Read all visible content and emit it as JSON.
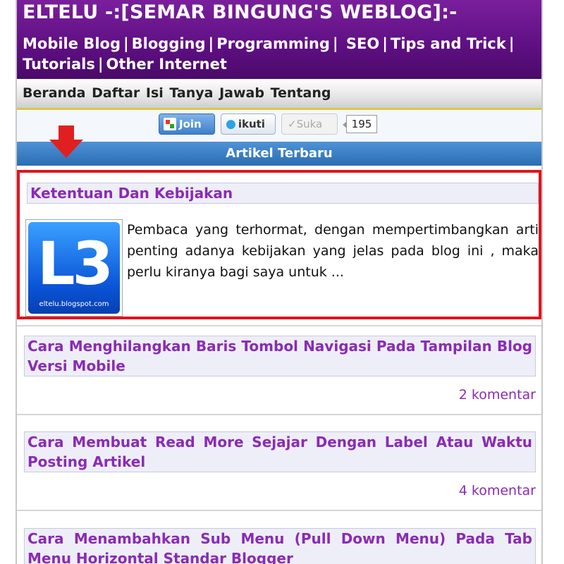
{
  "header": {
    "site_title": "ELTELU -:[SEMAR BINGUNG'S WEBLOG]:-",
    "nav": [
      {
        "label": "Mobile Blog"
      },
      {
        "label": "Blogging"
      },
      {
        "label": "Programming"
      },
      {
        "label": "SEO"
      },
      {
        "label": "Tips and Trick"
      },
      {
        "label": "Tutorials"
      },
      {
        "label": "Other Internet"
      }
    ],
    "separator": "|"
  },
  "subnav": {
    "items": [
      "Beranda",
      "Daftar Isi",
      "Tanya Jawab",
      "Tentang"
    ]
  },
  "social": {
    "join_label": "Join",
    "follow_label": "ikuti",
    "like_label": "Suka",
    "like_count": "195"
  },
  "section": {
    "title": "Artikel Terbaru"
  },
  "posts": [
    {
      "title": "Ketentuan Dan Kebijakan",
      "excerpt": "Pembaca yang terhormat, dengan mempertimbangkan arti penting adanya kebijakan yang jelas pada blog ini , maka perlu kiranya bagi saya untuk ...",
      "thumb_text": "L3",
      "thumb_url": "eltelu.blogspot.com"
    },
    {
      "title": "Cara Menghilangkan Baris Tombol Navigasi Pada Tampilan Blog Versi Mobile",
      "comments": "2 komentar"
    },
    {
      "title": "Cara Membuat Read More Sejajar Dengan Label Atau Waktu Posting Artikel",
      "comments": "4 komentar"
    },
    {
      "title": "Cara Menambahkan Sub Menu (Pull Down Menu) Pada Tab Menu Horizontal Standar Blogger"
    }
  ],
  "colors": {
    "header_bg": "#5e0f82",
    "link": "#8a2bb5",
    "section_bar": "#2a6db4",
    "highlight": "#e0141e",
    "arrow": "#e02020"
  }
}
